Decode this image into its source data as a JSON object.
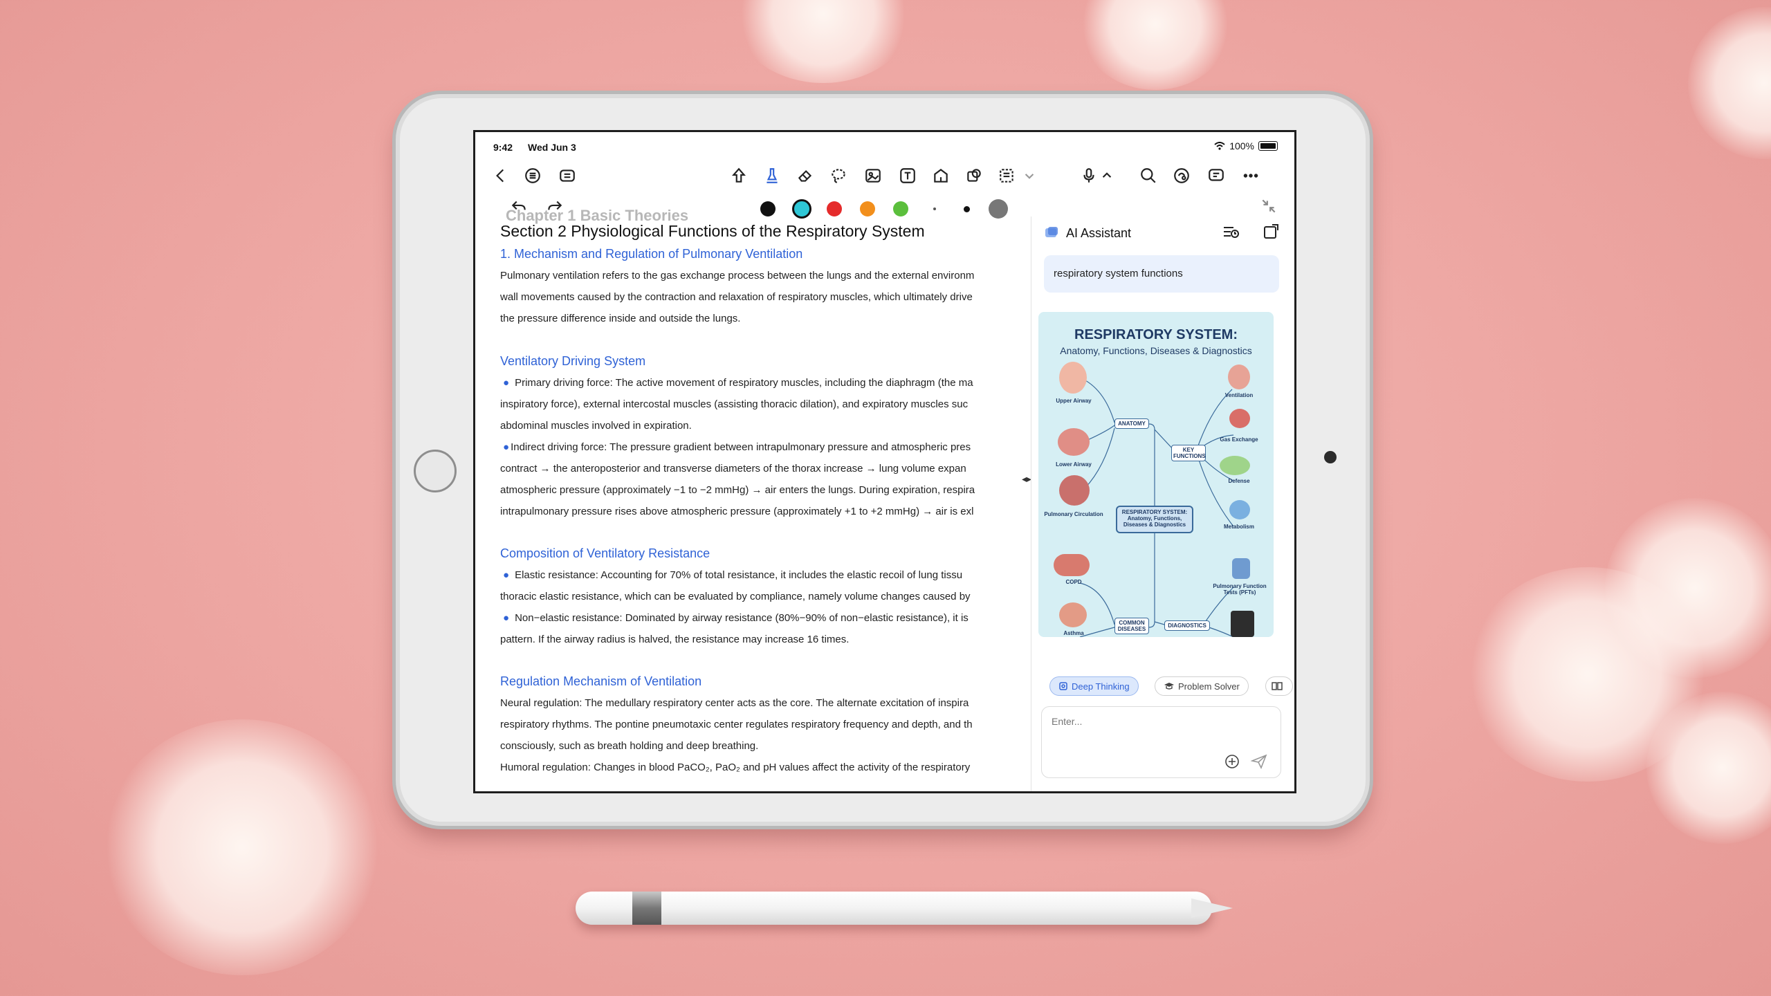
{
  "status_bar": {
    "time": "9:42",
    "date": "Wed Jun 3",
    "battery": "100%"
  },
  "toolbar": {
    "left_icons": [
      "back-chevron-icon",
      "outline-icon",
      "notes-icon"
    ],
    "tools": [
      "pointer-icon",
      "pen-icon",
      "eraser-icon",
      "lasso-icon",
      "image-icon",
      "text-icon",
      "shape-icon",
      "sticker-icon",
      "select-icon"
    ],
    "right_icons": [
      "microphone-icon",
      "search-icon",
      "ai-icon",
      "comment-icon",
      "more-icon"
    ]
  },
  "palette": {
    "colors": [
      "#111111",
      "#2ec7d6",
      "#e52b2b",
      "#f28f1c",
      "#5bbf3c"
    ],
    "selected": "#2ec7d6",
    "stroke_sizes": [
      "small",
      "medium",
      "large"
    ]
  },
  "document": {
    "chapter": "Chapter 1 Basic Theories",
    "section_title": "Section 2 Physiological Functions of the Respiratory System",
    "heading_1": "1. Mechanism and Regulation of Pulmonary Ventilation",
    "para_1": [
      "Pulmonary ventilation refers to the gas exchange process between the lungs and the external environm",
      "wall movements caused by the contraction and relaxation of respiratory muscles, which ultimately drive",
      "the pressure difference inside and outside the lungs."
    ],
    "heading_2": "Ventilatory Driving System",
    "para_2": [
      "Primary driving force: The active movement of respiratory muscles, including the diaphragm (the ma",
      "inspiratory force), external intercostal muscles (assisting thoracic dilation), and expiratory muscles suc",
      "abdominal muscles involved in expiration.",
      "Indirect driving force: The pressure gradient between intrapulmonary pressure and atmospheric pres",
      "contract → the anteroposterior and transverse diameters of the thorax increase → lung volume expan",
      "atmospheric pressure (approximately −1 to −2 mmHg) → air enters the lungs. During expiration, respira",
      "intrapulmonary pressure rises above atmospheric pressure (approximately +1 to +2 mmHg) → air is exl"
    ],
    "heading_3": "Composition of Ventilatory Resistance",
    "para_3": [
      "Elastic resistance: Accounting for 70% of total resistance, it includes the elastic recoil of lung tissu",
      "thoracic elastic resistance, which can be evaluated by compliance, namely volume changes caused by",
      "Non−elastic resistance: Dominated by airway resistance (80%−90% of non−elastic resistance), it is",
      "pattern. If the airway radius is halved, the resistance may increase 16 times."
    ],
    "heading_4": "Regulation Mechanism of Ventilation",
    "para_4": [
      "Neural regulation: The medullary respiratory center acts as the core. The alternate excitation of inspira",
      "respiratory rhythms. The pontine pneumotaxic center regulates respiratory frequency and depth, and th",
      "consciously, such as breath holding and deep breathing.",
      "Humoral regulation: Changes in blood PaCO₂, PaO₂ and pH values affect the activity of the respiratory"
    ]
  },
  "ai_panel": {
    "title": "AI Assistant",
    "query": "respiratory system functions",
    "infographic": {
      "title": "RESPIRATORY SYSTEM:",
      "subtitle": "Anatomy, Functions, Diseases & Diagnostics",
      "center": "RESPIRATORY SYSTEM: Anatomy, Functions, Diseases & Diagnostics",
      "branches": [
        "ANATOMY",
        "KEY FUNCTIONS",
        "COMMON DISEASES",
        "DIAGNOSTICS"
      ],
      "left_labels": [
        "Upper Airway",
        "Lower Airway",
        "Pulmonary Circulation",
        "COPD",
        "Asthma"
      ],
      "right_labels": [
        "Ventilation",
        "Gas Exchange",
        "Defense",
        "Metabolism",
        "Pulmonary Function Tests (PFTs)"
      ]
    },
    "chips": [
      "Deep Thinking",
      "Problem Solver"
    ],
    "input_placeholder": "Enter..."
  }
}
